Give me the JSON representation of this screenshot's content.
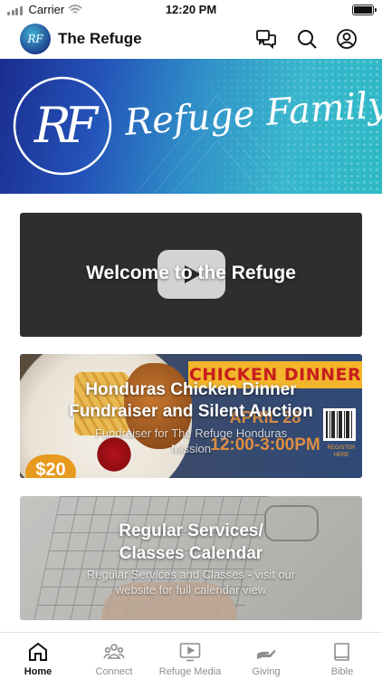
{
  "status_bar": {
    "carrier": "Carrier",
    "time": "12:20 PM"
  },
  "app": {
    "title": "The Refuge",
    "logo_text": "RF"
  },
  "header_icons": [
    "chat-icon",
    "search-icon",
    "profile-icon"
  ],
  "banner": {
    "monogram": "RF",
    "script_text": "Refuge Family"
  },
  "cards": [
    {
      "title": "Welcome to the Refuge",
      "subtitle": ""
    },
    {
      "title_lines": [
        "Honduras Chicken Dinner",
        "Fundraiser and Silent Auction"
      ],
      "subtitle_lines": [
        "Fundraiser for The Refuge Honduras",
        "Mission"
      ],
      "image": {
        "headline": "CHICKEN DINNER",
        "date": "APRIL 28",
        "time": "12:00-3:00PM",
        "price": "$20",
        "register": "REGISTER HERE"
      }
    },
    {
      "title_lines": [
        "Regular Services/",
        "Classes Calendar"
      ],
      "subtitle_lines": [
        "Regular Services and Classes - visit our",
        "website for full calendar view"
      ]
    }
  ],
  "tabs": [
    {
      "label": "Home",
      "icon": "home-icon",
      "active": true
    },
    {
      "label": "Connect",
      "icon": "group-icon",
      "active": false
    },
    {
      "label": "Refuge Media",
      "icon": "play-screen-icon",
      "active": false
    },
    {
      "label": "Giving",
      "icon": "giving-hand-icon",
      "active": false
    },
    {
      "label": "Bible",
      "icon": "book-icon",
      "active": false
    }
  ],
  "colors": {
    "accent": "#111111",
    "inactive": "#8e8e8e",
    "banner_start": "#1a2d8f",
    "banner_end": "#2db9c6"
  }
}
